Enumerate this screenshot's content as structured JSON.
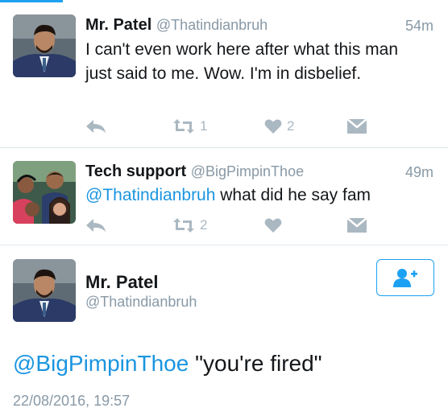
{
  "tweets": [
    {
      "name": "Mr. Patel",
      "handle": "@Thatindianbruh",
      "time": "54m",
      "text": "I can't even work here after what this man just said to me. Wow. I'm in disbelief.",
      "retweets": "1",
      "likes": "2"
    },
    {
      "name": "Tech support",
      "handle": "@BigPimpinThoe",
      "time": "49m",
      "mention": "@Thatindianbruh",
      "text": " what did he say fam",
      "retweets": "2",
      "likes": ""
    }
  ],
  "focal": {
    "name": "Mr. Patel",
    "handle": "@Thatindianbruh",
    "mention": "@BigPimpinThoe",
    "text": " \"you're fired\"",
    "date": "22/08/2016, 19:57"
  },
  "icons": {
    "reply": "reply-arrow-icon",
    "retweet": "retweet-icon",
    "like": "heart-icon",
    "dm": "envelope-icon",
    "follow": "add-user-icon"
  },
  "colors": {
    "accent": "#1da1f2",
    "link": "#1b95e0",
    "muted": "#8899a6",
    "action": "#aab8c2"
  }
}
